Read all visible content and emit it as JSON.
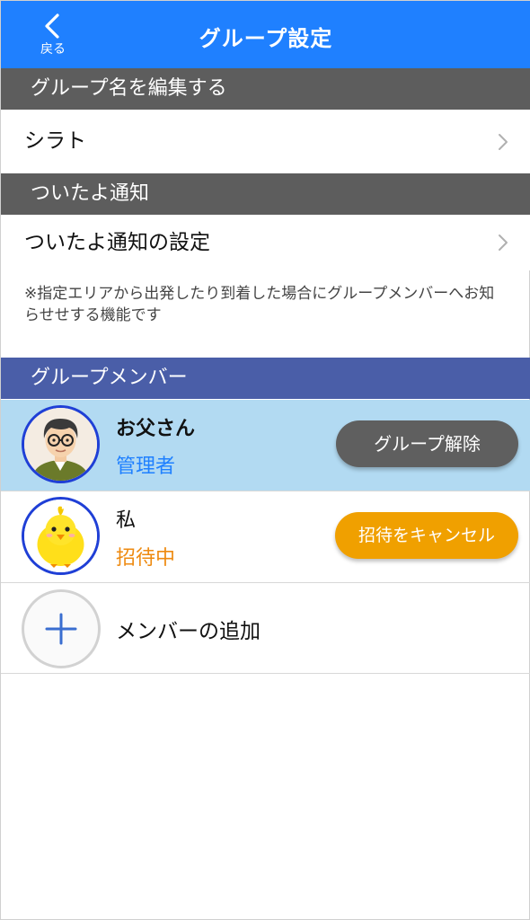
{
  "header": {
    "back_label": "戻る",
    "title": "グループ設定",
    "background_color": "#1f80ff"
  },
  "group_name_section": {
    "header": "グループ名を編集する",
    "value": "シラト"
  },
  "notification_section": {
    "header": "ついたよ通知",
    "setting_label": "ついたよ通知の設定",
    "note": "※指定エリアから出発したり到着した場合にグループメンバーへお知らせせする機能です"
  },
  "members_section": {
    "header": "グループメンバー",
    "members": [
      {
        "name": "お父さん",
        "status": "管理者",
        "status_color": "#1f80ff",
        "action_label": "グループ解除",
        "action_color": "#5f5f5f",
        "avatar_icon": "father-avatar-icon"
      },
      {
        "name": "私",
        "status": "招待中",
        "status_color": "#ee8a10",
        "action_label": "招待をキャンセル",
        "action_color": "#f0a000",
        "avatar_icon": "chick-avatar-icon"
      }
    ],
    "add_member_label": "メンバーの追加"
  }
}
